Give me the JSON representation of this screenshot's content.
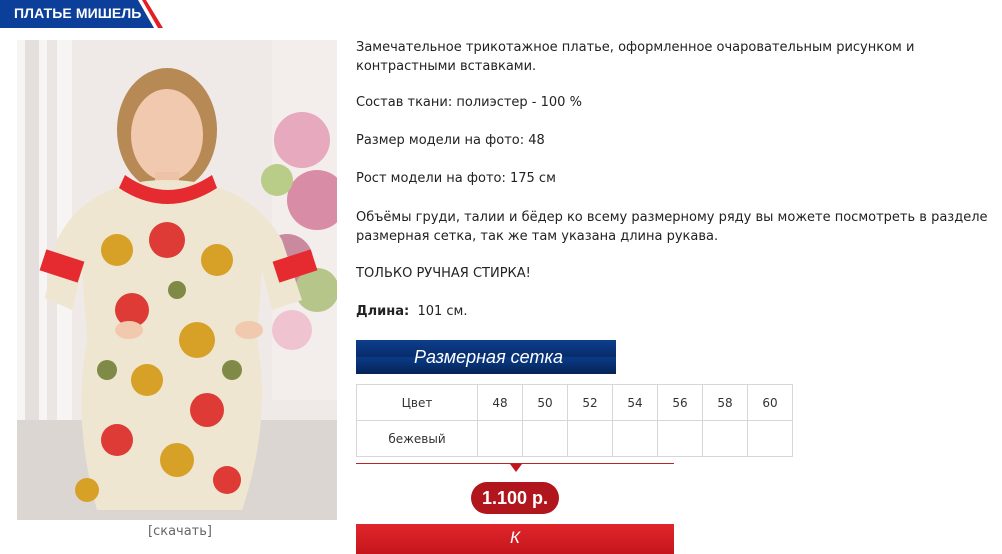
{
  "product": {
    "title": "ПЛАТЬЕ МИШЕЛЬ",
    "download_label": "[скачать]",
    "description": "Замечательное трикотажное платье, оформленное очаровательным рисунком и контрастными вставками.",
    "fabric": "Состав ткани:  полиэстер - 100 %",
    "model_size": "Размер модели на фото: 48",
    "model_height": "Рост модели на фото: 175 см",
    "measurements_note": "Объёмы груди, талии и бёдер ко всему размерному ряду вы можете посмотреть в разделе размерная сетка, так же там указана длина рукава.",
    "care": "ТОЛЬКО РУЧНАЯ СТИРКА!",
    "length_label": "Длина:",
    "length_value": "101 см."
  },
  "size_chart": {
    "button_label": "Размерная сетка",
    "header": [
      "Цвет",
      "48",
      "50",
      "52",
      "54",
      "56",
      "58",
      "60"
    ],
    "rows": [
      {
        "color": "бежевый"
      }
    ]
  },
  "price": "1.100 р.",
  "buy_button_label": "К",
  "colors": {
    "title_tab": "#0c3f99",
    "title_accent": "#e31e24",
    "size_button": "#0b3a84",
    "price_badge": "#b0161c",
    "buy_button": "#d11f24"
  },
  "icons": {
    "arrow": "down-triangle"
  }
}
